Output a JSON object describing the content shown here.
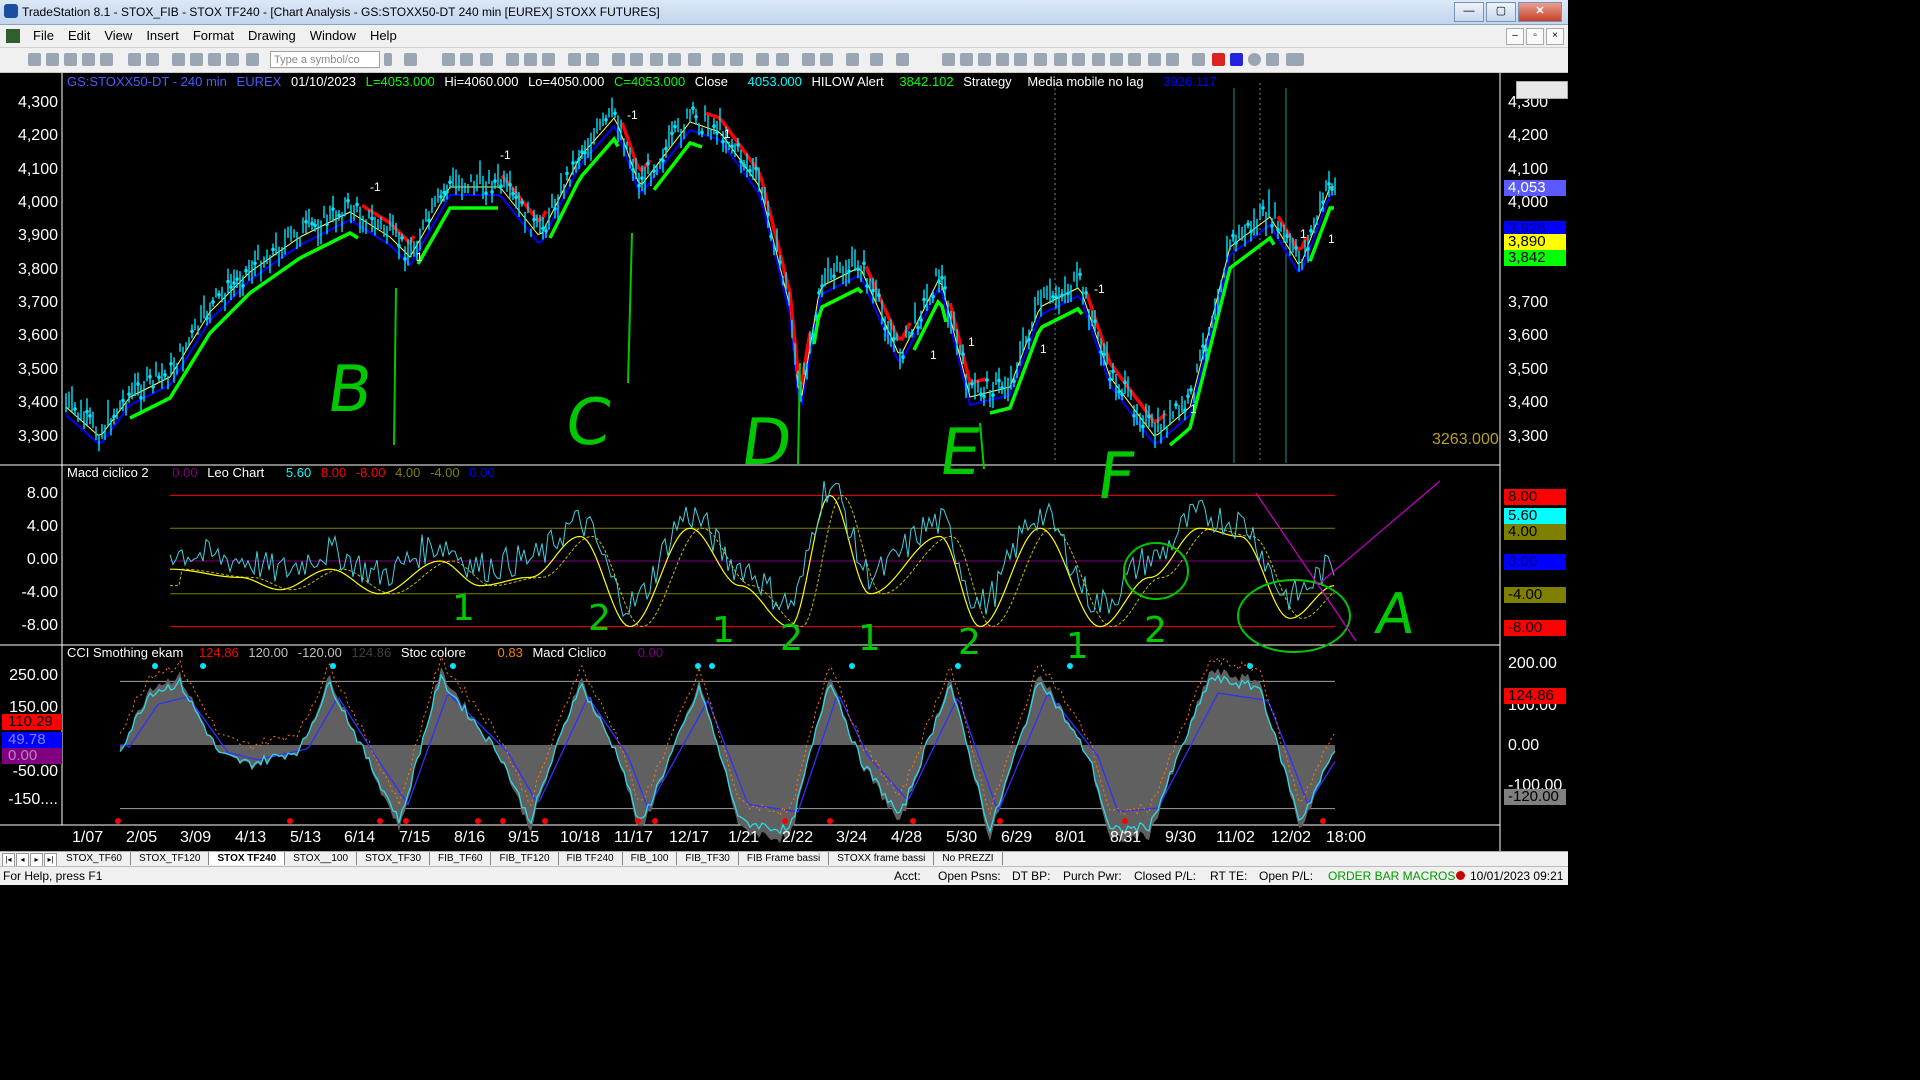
{
  "window": {
    "title": "TradeStation 8.1 - STOX_FIB - STOX TF240 - [Chart Analysis - GS:STOXX50-DT  240 min  [EUREX] STOXX FUTURES]",
    "buttons": [
      "—",
      "▢",
      "✕"
    ]
  },
  "menu": [
    "File",
    "Edit",
    "View",
    "Insert",
    "Format",
    "Drawing",
    "Window",
    "Help"
  ],
  "toolbar": {
    "symbol_placeholder": "Type a symbol/co"
  },
  "price_panel": {
    "legend": {
      "symbol": "GS:STOXX50-DT - 240 min",
      "exchange": "EUREX",
      "date": "01/10/2023",
      "last": "L=4053.000",
      "high": "Hi=4060.000",
      "low": "Lo=4050.000",
      "close_val": "C=4053.000",
      "close_label": "Close",
      "close_value": "4053.000",
      "hilow_label": "HILOW Alert",
      "hilow_value": "3842.102",
      "strategy_label": "Strategy",
      "mm_label": "Media mobile no lag",
      "mm_value": "3926.117"
    },
    "yaxis": [
      "4,300",
      "4,200",
      "4,100",
      "4,000",
      "3,900",
      "3,800",
      "3,700",
      "3,600",
      "3,500",
      "3,400",
      "3,300"
    ],
    "tags": [
      {
        "text": "4,053",
        "bg": "#5a5aff",
        "color": "#ffffff"
      },
      {
        "text": "3,926",
        "bg": "#0000ff",
        "color": "#000080"
      },
      {
        "text": "3,890",
        "bg": "#ffff00",
        "color": "#000000"
      },
      {
        "text": "3,842",
        "bg": "#00ff00",
        "color": "#000000"
      }
    ],
    "floor_label": "3263.000",
    "annotations": [
      "B",
      "C",
      "D",
      "E",
      "F"
    ],
    "marks": [
      "-1",
      "-1",
      "-1",
      "-1",
      "1",
      "1",
      "1",
      "1",
      "1",
      "-1",
      "1",
      "1"
    ],
    "colors": {
      "price": "#00e5ff",
      "down": "#ff0000",
      "up": "#00ff00",
      "mm": "#0000ff",
      "avg": "#ffff66"
    }
  },
  "macd_panel": {
    "legend": {
      "name": "Macd ciclico 2",
      "v0": "0.00",
      "leo": "Leo Chart",
      "v1": "5.60",
      "v2": "8.00",
      "v3": "-8.00",
      "v4": "4.00",
      "v5": "-4.00",
      "v6": "0.00"
    },
    "yaxis": [
      "8.00",
      "4.00",
      "0.00",
      "-4.00",
      "-8.00"
    ],
    "tags": [
      {
        "text": "8.00",
        "bg": "#ff0000",
        "color": "#000000"
      },
      {
        "text": "5.60",
        "bg": "#00ffff",
        "color": "#000000"
      },
      {
        "text": "4.00",
        "bg": "#808000",
        "color": "#000000"
      },
      {
        "text": "0.00",
        "bg": "#0000ff",
        "color": "#000080"
      },
      {
        "text": "-4.00",
        "bg": "#808000",
        "color": "#000000"
      },
      {
        "text": "-8.00",
        "bg": "#ff0000",
        "color": "#000000"
      }
    ],
    "annotations": [
      "1",
      "2",
      "1",
      "2",
      "1",
      "2",
      "1",
      "2",
      "A"
    ]
  },
  "cci_panel": {
    "legend": {
      "name": "CCI Smothing ekam",
      "v1": "124.86",
      "v2": "120.00",
      "v3": "-120.00",
      "v4": "124.86",
      "stoc": "Stoc colore",
      "v5": "0.83",
      "macd": "Macd Ciclico",
      "v6": "0.00"
    },
    "yaxis_left": [
      "250.00",
      "150.00",
      "-50.00",
      "-150...."
    ],
    "yaxis_right": [
      "200.00",
      "100.00",
      "0.00",
      "-100.00"
    ],
    "tags_left": [
      {
        "text": "110.29",
        "bg": "#ff0000",
        "color": "#000000"
      },
      {
        "text": "49.78",
        "bg": "#0000ff",
        "color": "#8080ff"
      },
      {
        "text": "0.00",
        "bg": "#800080",
        "color": "#c080c0"
      }
    ],
    "tags_right": [
      {
        "text": "124.86",
        "bg": "#ff0000",
        "color": "#000000"
      },
      {
        "text": "-120.00",
        "bg": "#808080",
        "color": "#000000"
      }
    ]
  },
  "xaxis": [
    "1/07",
    "2/05",
    "3/09",
    "4/13",
    "5/13",
    "6/14",
    "7/15",
    "8/16",
    "9/15",
    "10/18",
    "11/17",
    "12/17",
    "1/21",
    "2/22",
    "3/24",
    "4/28",
    "5/30",
    "6/29",
    "8/01",
    "8/31",
    "9/30",
    "11/02",
    "12/02",
    "18:00"
  ],
  "tabs": [
    "STOX_TF60",
    "STOX_TF120",
    "STOX TF240",
    "STOX__100",
    "STOX_TF30",
    "FIB_TF60",
    "FIB_TF120",
    "FIB TF240",
    "FIB_100",
    "FIB_TF30",
    "FIB Frame bassi",
    "STOXX frame bassi",
    "No PREZZI"
  ],
  "active_tab": "STOX TF240",
  "status": {
    "help": "For Help, press F1",
    "acct": "Acct:",
    "open_psns": "Open Psns:",
    "dt_bp": "DT BP:",
    "purch_pwr": "Purch Pwr:",
    "closed_pl": "Closed P/L:",
    "rt_te": "RT TE:",
    "open_pl": "Open P/L:",
    "order": "ORDER BAR  MACROS",
    "datetime": "10/01/2023 09:21"
  }
}
